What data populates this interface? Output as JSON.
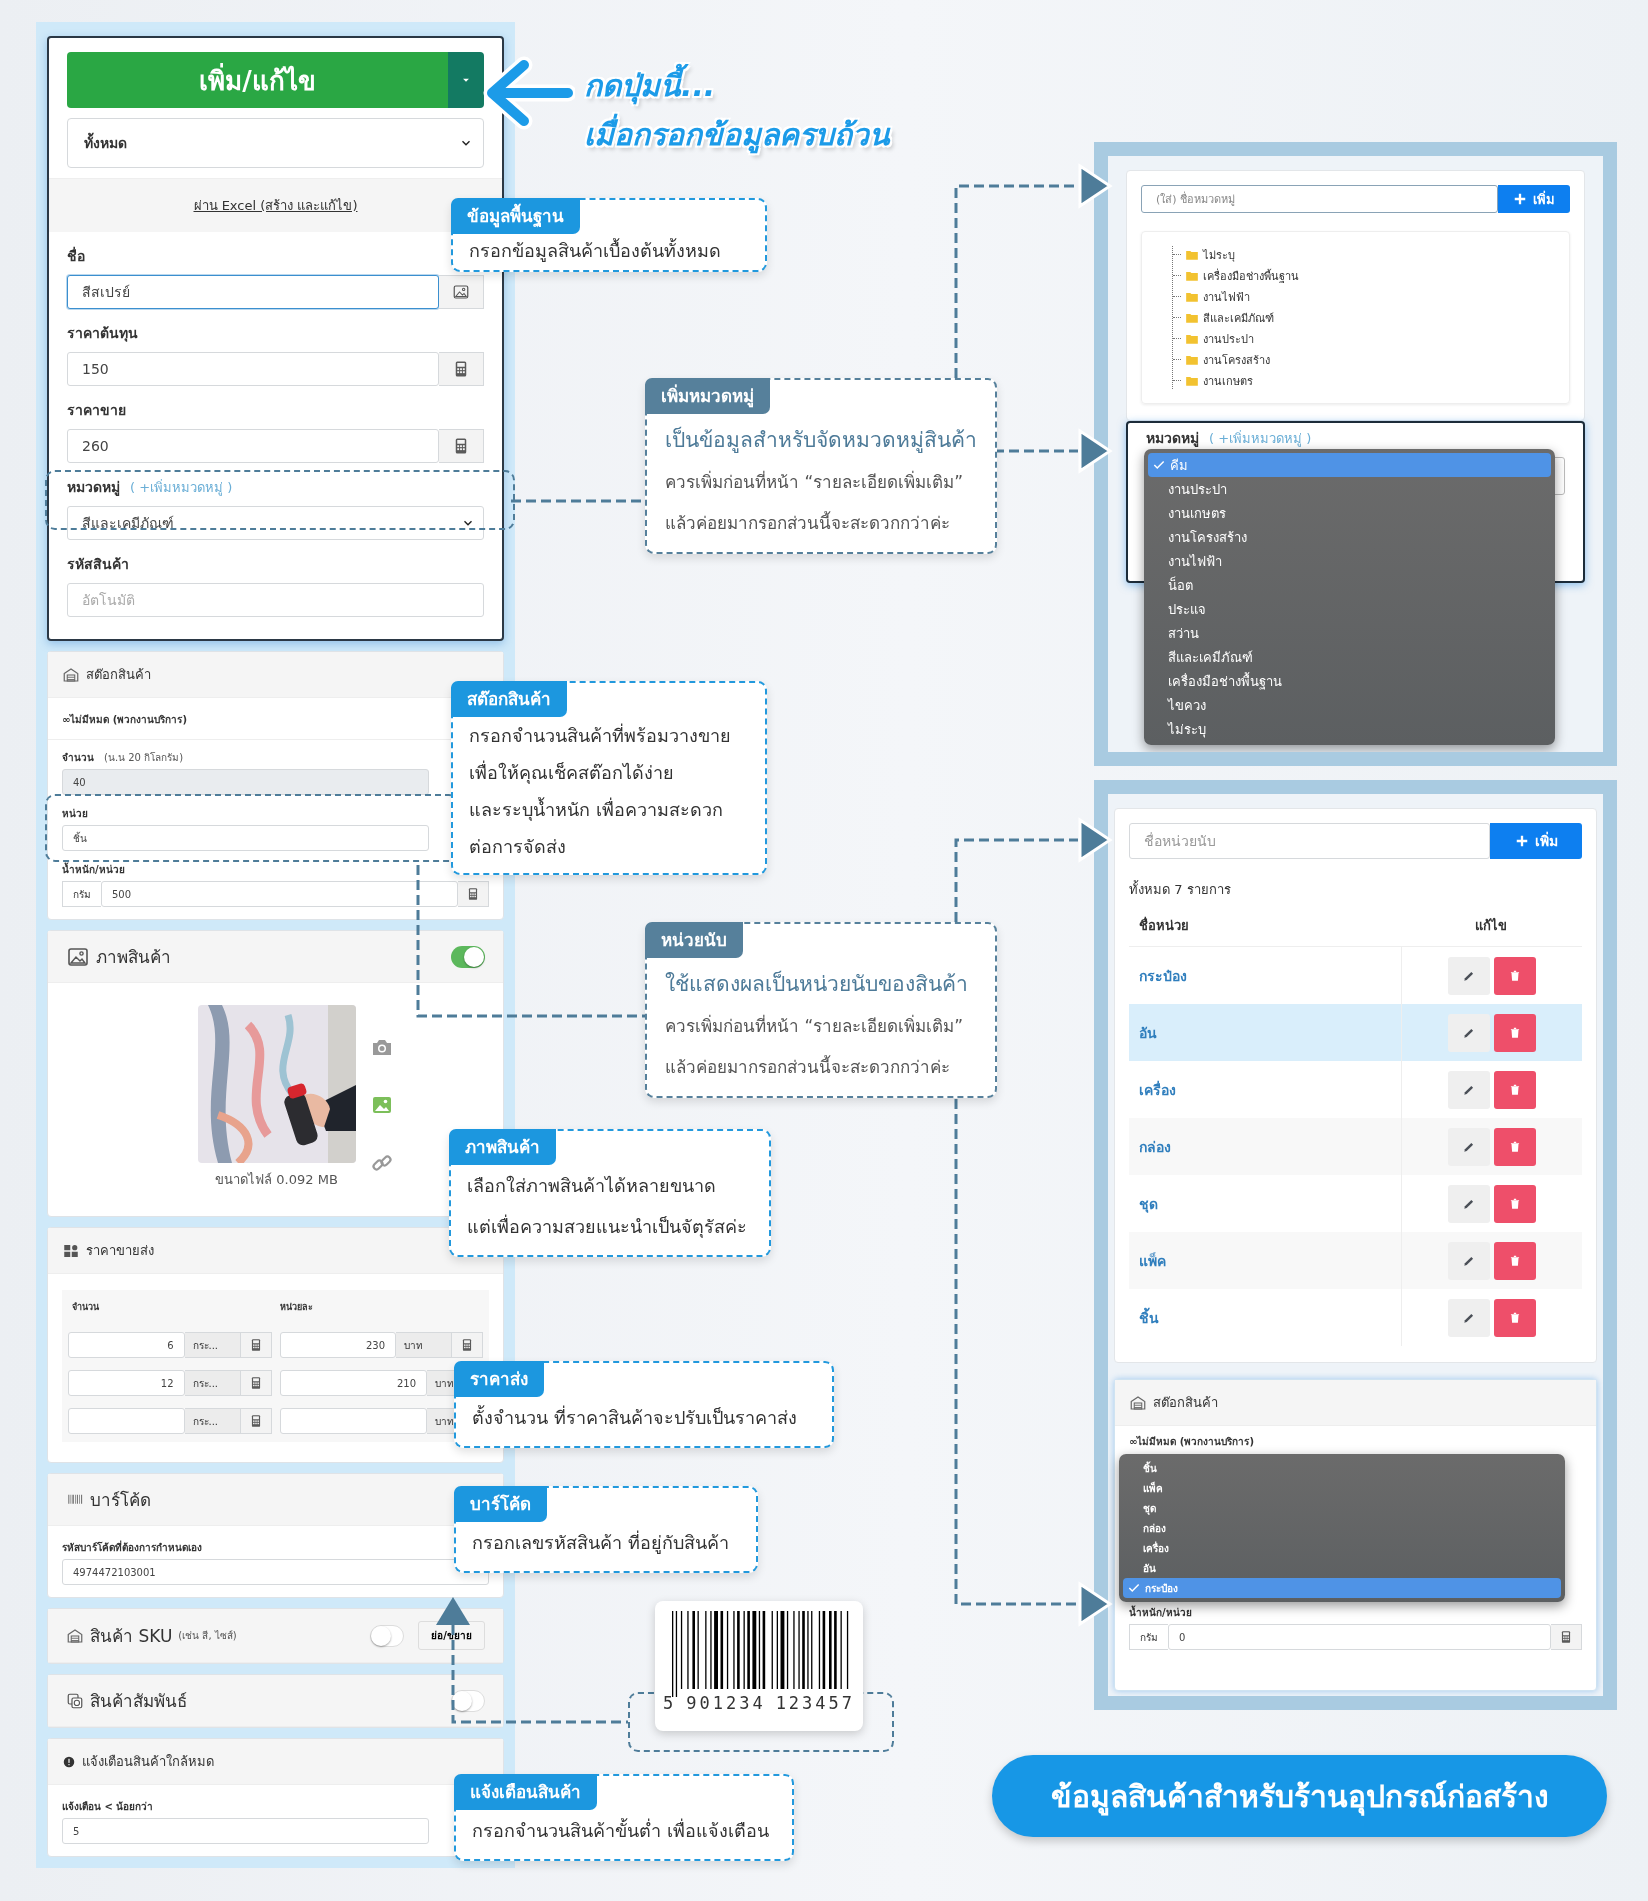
{
  "headline": {
    "title": "กดปุ่มนี้...",
    "subtitle": "เมื่อกรอกข้อมูลครบถ้วน"
  },
  "form": {
    "save_button": "เพิ่ม/แก้ไข",
    "filter_select": "ทั้งหมด",
    "excel_link": "ผ่าน Excel (สร้าง และแก้ไข)",
    "basic_fields": [
      {
        "kind": "image-input",
        "label": "ชื่อ",
        "value": "สีสเปรย์",
        "focused": true
      },
      {
        "kind": "number-input",
        "label": "ราคาต้นทุน",
        "value": "150",
        "focused": false
      },
      {
        "kind": "number-input",
        "label": "ราคาขาย",
        "value": "260",
        "focused": false
      },
      {
        "kind": "select",
        "label": "หมวดหมู่",
        "link": "( +เพิ่มหมวดหมู่ )",
        "value": "สีและเคมีภัณฑ์",
        "focused": false
      },
      {
        "kind": "input",
        "label": "รหัสสินค้า",
        "placeholder": "อัตโนมัติ",
        "focused": false
      }
    ],
    "stock": {
      "title": "สต๊อกสินค้า",
      "unlimited": "∞ไม่มีหมด (พวกงานบริการ)",
      "quantity_label": "จำนวน",
      "quantity_hint": "(น.น 20 กิโลกรัม)",
      "quantity": "40",
      "quantity_disabled": true,
      "unit_label": "หน่วย",
      "unit": "ชิ้น",
      "weight_label": "น้ำหนัก/หน่วย",
      "weight_unit": "กรัม",
      "weight": "500"
    },
    "image": {
      "title": "ภาพสินค้า",
      "enabled": true,
      "file_size": "ขนาดไฟล์ 0.092 MB"
    },
    "wholesale": {
      "title": "ราคาขายส่ง",
      "columns": [
        "จำนวน",
        "หน่วยละ"
      ],
      "rows": [
        {
          "quantity": "6",
          "unit": "กระ...",
          "price": "230",
          "currency": "บาท"
        },
        {
          "quantity": "12",
          "unit": "กระ...",
          "price": "210",
          "currency": "บาท"
        },
        {
          "unit": "กระ...",
          "currency": "บาท"
        }
      ]
    },
    "barcode": {
      "title": "บาร์โค้ด",
      "label": "รหัสบาร์โค้ดที่ต้องการกำหนดเอง",
      "value": "4974472103001"
    },
    "sku": {
      "title": "สินค้า SKU",
      "hint": "(เช่น สี, ไซส์)",
      "enabled": false,
      "toggle_button": "ย่อ/ขยาย"
    },
    "related": {
      "title": "สินค้าสัมพันธ์",
      "enabled": false
    },
    "alert": {
      "title": "แจ้งเตือนสินค้าใกล้หมด",
      "label": "แจ้งเตือน < น้อยกว่า",
      "value": "5"
    }
  },
  "callouts": [
    {
      "kind": "basic",
      "title": "ข้อมูลพื้นฐาน",
      "lines": [
        "กรอกข้อมูลสินค้าเบื้องต้นทั้งหมด"
      ]
    },
    {
      "kind": "detail",
      "title": "เพิ่มหมวดหมู่",
      "lead": "เป็นข้อมูลสำหรับจัดหมวดหมู่สินค้า",
      "lines": [
        "ควรเพิ่มก่อนที่หน้า “รายละเอียดเพิ่มเติม”",
        "แล้วค่อยมากรอกส่วนนี้จะสะดวกกว่าค่ะ"
      ]
    },
    {
      "kind": "basic",
      "title": "สต๊อกสินค้า",
      "lines": [
        "กรอกจำนวนสินค้าที่พร้อมวางขาย",
        "เพื่อให้คุณเช็คสต๊อกได้ง่าย",
        "และระบุน้ำหนัก เพื่อความสะดวก",
        "ต่อการจัดส่ง"
      ]
    },
    {
      "kind": "detail",
      "title": "หน่วยนับ",
      "lead": "ใช้แสดงผลเป็นหน่วยนับของสินค้า",
      "lines": [
        "ควรเพิ่มก่อนที่หน้า “รายละเอียดเพิ่มเติม”",
        "แล้วค่อยมากรอกส่วนนี้จะสะดวกกว่าค่ะ"
      ]
    },
    {
      "kind": "basic",
      "title": "ภาพสินค้า",
      "lines": [
        "เลือกใส่ภาพสินค้าได้หลายขนาด",
        "แต่เพื่อความสวยแนะนำเป็นจัตุรัสค่ะ"
      ]
    },
    {
      "kind": "basic",
      "title": "ราคาส่ง",
      "lines": [
        "ตั้งจำนวน ที่ราคาสินค้าจะปรับเป็นราคาส่ง"
      ]
    },
    {
      "kind": "basic",
      "title": "บาร์โค้ด",
      "lines": [
        "กรอกเลขรหัสสินค้า ที่อยู่กับสินค้า"
      ]
    },
    {
      "kind": "basic",
      "title": "แจ้งเตือนสินค้า",
      "lines": [
        "กรอกจำนวนสินค้าขั้นต่ำ เพื่อแจ้งเตือน"
      ]
    }
  ],
  "barcode_sample": {
    "digits": [
      "5",
      "901234",
      "123457"
    ]
  },
  "category_panel": {
    "placeholder": "(ใส่) ชื่อหมวดหมู่",
    "add_button": "เพิ่ม",
    "folders": [
      "ไม่ระบุ",
      "เครื่องมือช่างพื้นฐาน",
      "งานไฟฟ้า",
      "สีและเคมีภัณฑ์",
      "งานประปา",
      "งานโครงสร้าง",
      "งานเกษตร"
    ],
    "field_label": "หมวดหมู่",
    "field_link": "( +เพิ่มหมวดหมู่ )",
    "dropdown": [
      {
        "label": "คีม",
        "selected": true
      },
      {
        "label": "งานประปา",
        "selected": false
      },
      {
        "label": "งานเกษตร",
        "selected": false
      },
      {
        "label": "งานโครงสร้าง",
        "selected": false
      },
      {
        "label": "งานไฟฟ้า",
        "selected": false
      },
      {
        "label": "น็อต",
        "selected": false
      },
      {
        "label": "ประแจ",
        "selected": false
      },
      {
        "label": "สว่าน",
        "selected": false
      },
      {
        "label": "สีและเคมีภัณฑ์",
        "selected": false
      },
      {
        "label": "เครื่องมือช่างพื้นฐาน",
        "selected": false
      },
      {
        "label": "ไขควง",
        "selected": false
      },
      {
        "label": "ไม่ระบุ",
        "selected": false
      }
    ]
  },
  "unit_panel": {
    "placeholder": "ชื่อหน่วยนับ",
    "add_button": "เพิ่ม",
    "total": "ทั้งหมด 7 รายการ",
    "columns": [
      "ชื่อหน่วย",
      "แก้ไข"
    ],
    "rows": [
      {
        "name": "กระป๋อง",
        "highlighted": false
      },
      {
        "name": "อัน",
        "highlighted": true
      },
      {
        "name": "เครื่อง",
        "highlighted": false
      },
      {
        "name": "กล่อง",
        "highlighted": false
      },
      {
        "name": "ชุด",
        "highlighted": false
      },
      {
        "name": "แพ็ค",
        "highlighted": false
      },
      {
        "name": "ชิ้น",
        "highlighted": false
      }
    ],
    "stock": {
      "title": "สต๊อกสินค้า",
      "unlimited": "∞ไม่มีหมด (พวกงานบริการ)",
      "weight_label": "น้ำหนัก/หน่วย",
      "weight_unit": "กรัม",
      "weight": "0",
      "dropdown": [
        {
          "label": "ชิ้น",
          "selected": false
        },
        {
          "label": "แพ็ค",
          "selected": false
        },
        {
          "label": "ชุด",
          "selected": false
        },
        {
          "label": "กล่อง",
          "selected": false
        },
        {
          "label": "เครื่อง",
          "selected": false
        },
        {
          "label": "อัน",
          "selected": false
        },
        {
          "label": "กระป๋อง",
          "selected": true
        }
      ]
    }
  },
  "banner": "ข้อมูลสินค้าสำหรับร้านอุปกรณ์ก่อสร้าง"
}
